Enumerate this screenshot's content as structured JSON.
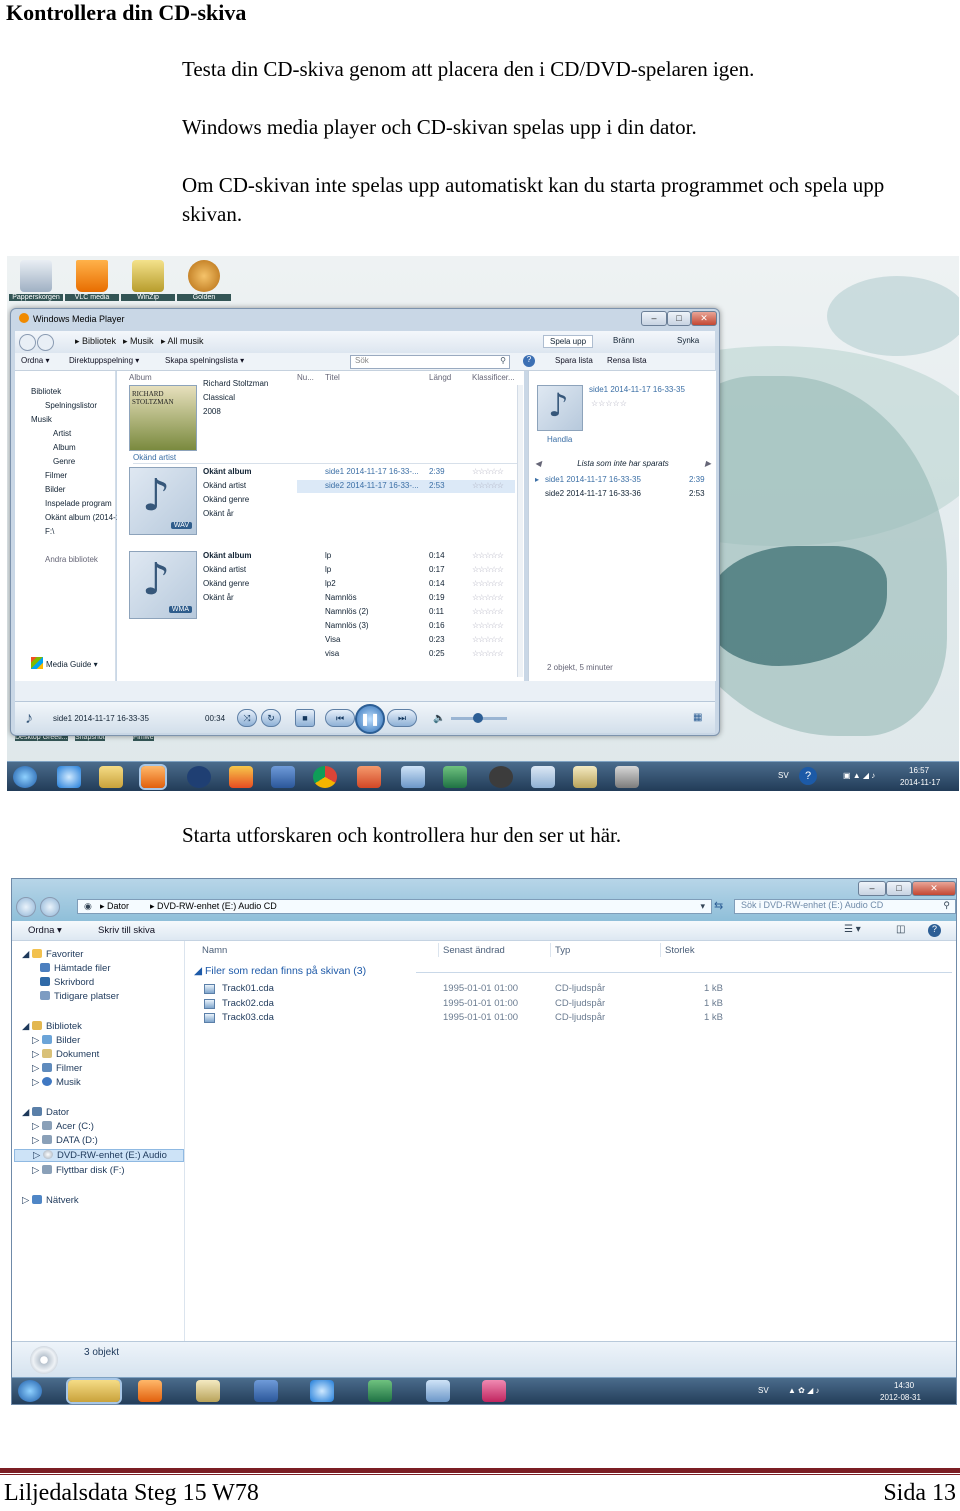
{
  "heading": "Kontrollera din CD-skiva",
  "paragraphs": [
    "Testa din CD-skiva genom att placera den i CD/DVD-spelaren igen.",
    "Windows media player och CD-skivan spelas upp i din dator.",
    "Om CD-skivan inte spelas upp automatiskt kan du starta programmet och spela upp skivan."
  ],
  "para2": "Starta utforskaren och kontrollera hur den ser ut här.",
  "footer": {
    "left": "Liljedalsdata Steg 15 W78",
    "right": "Sida 13"
  },
  "desktop": {
    "icons": [
      "Papperskorgen",
      "VLC media",
      "WinZip",
      "Golden"
    ],
    "bottom_icons": [
      "Desktop Greeti...",
      "Snapshot",
      "Fimwe"
    ]
  },
  "wmp": {
    "title": "Windows Media Player",
    "breadcrumb": [
      "Bibliotek",
      "Musik",
      "All musik"
    ],
    "toolbar": [
      "Ordna",
      "Direktuppspelning",
      "Skapa spelningslista"
    ],
    "search_placeholder": "Sök",
    "tabs": [
      "Spela upp",
      "Bränn",
      "Synka"
    ],
    "right_tools": [
      "Spara lista",
      "Rensa lista"
    ],
    "nav": [
      "Bibliotek",
      "Spelningslistor",
      "Musik",
      "Artist",
      "Album",
      "Genre",
      "Filmer",
      "Bilder",
      "Inspelade program",
      "Okänt album (2014-1",
      "F:\\",
      "Andra bibliotek",
      "Media Guide"
    ],
    "columns": [
      "Album",
      "Nu...",
      "Titel",
      "Längd",
      "Klassificer..."
    ],
    "album_header": "Okänd artist",
    "album1": {
      "art_top": "RICHARD STOLTZMAN",
      "lines": [
        "Richard Stoltzman",
        "Classical",
        "2008"
      ]
    },
    "album2": {
      "lines": [
        "Okänt album",
        "Okänd artist",
        "Okänd genre",
        "Okänt år"
      ],
      "format": "WAV"
    },
    "album3": {
      "lines": [
        "Okänt album",
        "Okänd artist",
        "Okänd genre",
        "Okänt år"
      ],
      "format": "WMA"
    },
    "tracks_wav": [
      {
        "title": "side1 2014-11-17 16-33-...",
        "length": "2:39"
      },
      {
        "title": "side2 2014-11-17 16-33-...",
        "length": "2:53"
      }
    ],
    "tracks_wma": [
      {
        "title": "lp",
        "length": "0:14"
      },
      {
        "title": "lp",
        "length": "0:17"
      },
      {
        "title": "lp2",
        "length": "0:14"
      },
      {
        "title": "Namnlös",
        "length": "0:19"
      },
      {
        "title": "Namnlös (2)",
        "length": "0:11"
      },
      {
        "title": "Namnlös (3)",
        "length": "0:16"
      },
      {
        "title": "Visa",
        "length": "0:23"
      },
      {
        "title": "visa",
        "length": "0:25"
      }
    ],
    "now_playing": {
      "title": "side1 2014-11-17 16-33-35",
      "label": "Handla"
    },
    "list_header": "Lista som inte har sparats",
    "playlist": [
      {
        "title": "side1 2014-11-17 16-33-35",
        "length": "2:39"
      },
      {
        "title": "side2 2014-11-17 16-33-36",
        "length": "2:53"
      }
    ],
    "list_status": "2 objekt, 5 minuter",
    "player_track": "side1 2014-11-17 16-33-35",
    "player_time": "00:34"
  },
  "taskbar1": {
    "lang": "SV",
    "time": "16:57",
    "date": "2014-11-17"
  },
  "explorer": {
    "address": [
      "Dator",
      "DVD-RW-enhet (E:) Audio CD"
    ],
    "search_placeholder": "Sök i DVD-RW-enhet (E:) Audio CD",
    "toolbar": [
      "Ordna",
      "Skriv till skiva"
    ],
    "nav": [
      "Favoriter",
      "Hämtade filer",
      "Skrivbord",
      "Tidigare platser",
      "Bibliotek",
      "Bilder",
      "Dokument",
      "Filmer",
      "Musik",
      "Dator",
      "Acer (C:)",
      "DATA (D:)",
      "DVD-RW-enhet (E:) Audio",
      "Flyttbar disk (F:)",
      "Nätverk"
    ],
    "columns": [
      "Namn",
      "Senast ändrad",
      "Typ",
      "Storlek"
    ],
    "group": "Filer som redan finns på skivan (3)",
    "files": [
      {
        "name": "Track01.cda",
        "date": "1995-01-01 01:00",
        "type": "CD-ljudspår",
        "size": "1 kB"
      },
      {
        "name": "Track02.cda",
        "date": "1995-01-01 01:00",
        "type": "CD-ljudspår",
        "size": "1 kB"
      },
      {
        "name": "Track03.cda",
        "date": "1995-01-01 01:00",
        "type": "CD-ljudspår",
        "size": "1 kB"
      }
    ],
    "status": "3 objekt"
  },
  "taskbar2": {
    "lang": "SV",
    "time": "14:30",
    "date": "2012-08-31"
  }
}
